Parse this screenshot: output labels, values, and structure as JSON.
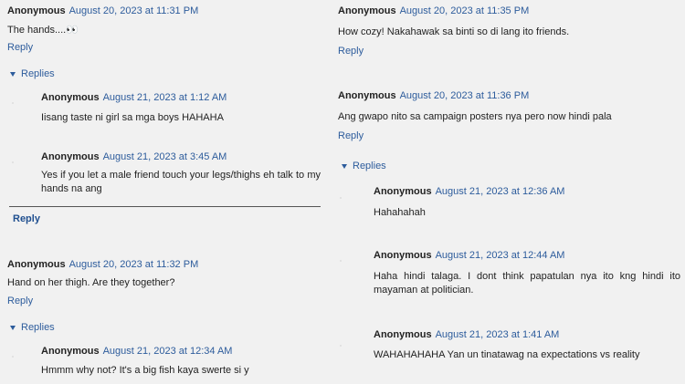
{
  "left": {
    "c1": {
      "author": "Anonymous",
      "date": "August 20, 2023 at 11:31 PM",
      "text": "The hands....",
      "emoji": "👀",
      "reply": "Reply"
    },
    "replies_label": "Replies",
    "r1": {
      "author": "Anonymous",
      "date": "August 21, 2023 at 1:12 AM",
      "text": "Iisang taste ni girl sa mga boys HAHAHA"
    },
    "r2": {
      "author": "Anonymous",
      "date": "August 21, 2023 at 3:45 AM",
      "text": "Yes if you let a male friend touch your legs/thighs eh talk to my hands na ang"
    },
    "reply_bold": "Reply",
    "c2": {
      "author": "Anonymous",
      "date": "August 20, 2023 at 11:32 PM",
      "text": "Hand on her thigh. Are they together?",
      "reply": "Reply"
    },
    "replies_label2": "Replies",
    "r3": {
      "author": "Anonymous",
      "date": "August 21, 2023 at 12:34 AM",
      "text": "Hmmm why not? It's a big fish kaya swerte si y"
    }
  },
  "right": {
    "c1": {
      "author": "Anonymous",
      "date": "August 20, 2023 at 11:35 PM",
      "text": "How cozy! Nakahawak sa binti so di lang ito friends.",
      "reply": "Reply"
    },
    "c2": {
      "author": "Anonymous",
      "date": "August 20, 2023 at 11:36 PM",
      "text": "Ang gwapo nito sa campaign posters nya pero now hindi pala",
      "reply": "Reply"
    },
    "replies_label": "Replies",
    "r1": {
      "author": "Anonymous",
      "date": "August 21, 2023 at 12:36 AM",
      "text": "Hahahahah"
    },
    "r2": {
      "author": "Anonymous",
      "date": "August 21, 2023 at 12:44 AM",
      "text": "Haha hindi talaga. I dont think papatulan nya ito kng hindi ito mayaman at politician."
    },
    "r3": {
      "author": "Anonymous",
      "date": "August 21, 2023 at 1:41 AM",
      "text": "WAHAHAHAHA Yan un tinatawag na expectations vs reality"
    }
  },
  "colors": {
    "link": "#2d5c9c",
    "background": "#f1f1f1",
    "text": "#222222"
  }
}
